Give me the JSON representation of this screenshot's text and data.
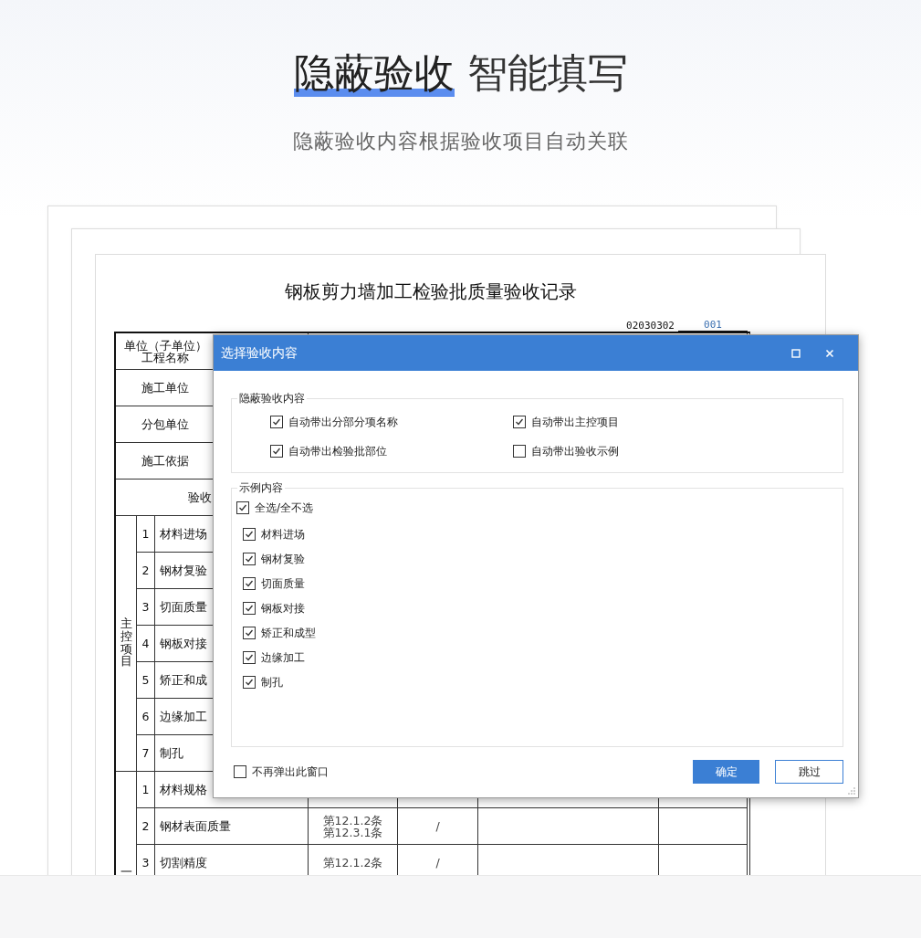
{
  "header": {
    "title_highlight": "隐蔽验收",
    "title_rest": "智能填写",
    "subtitle": "隐蔽验收内容根据验收项目自动关联"
  },
  "document": {
    "title": "钢板剪力墙加工检验批质量验收记录",
    "code": "02030302",
    "serial": "001",
    "info_rows": [
      {
        "lines": [
          "单位（子单位）",
          "工程名称"
        ]
      },
      {
        "lines": [
          "施工单位"
        ]
      },
      {
        "lines": [
          "分包单位"
        ]
      },
      {
        "lines": [
          "施工依据"
        ]
      }
    ],
    "section_label": "验收",
    "groups": [
      {
        "label": "主控项目",
        "rows": [
          {
            "no": "1",
            "name": "材料进场"
          },
          {
            "no": "2",
            "name": "钢材复验"
          },
          {
            "no": "3",
            "name": "切面质量"
          },
          {
            "no": "4",
            "name": "钢板对接"
          },
          {
            "no": "5",
            "name": "矫正和成"
          },
          {
            "no": "6",
            "name": "边缘加工"
          },
          {
            "no": "7",
            "name": "制孔"
          }
        ]
      },
      {
        "label": "一",
        "rows": [
          {
            "no": "1",
            "name": "材料规格"
          },
          {
            "no": "2",
            "name": "钢材表面质量",
            "clause": [
              "第12.1.2条",
              "第12.3.1条"
            ],
            "result": "/"
          },
          {
            "no": "3",
            "name": "切割精度",
            "clause": [
              "第12.1.2条"
            ],
            "result": "/"
          }
        ]
      }
    ]
  },
  "dialog": {
    "title": "选择验收内容",
    "hidden_group": {
      "title": "隐蔽验收内容",
      "options": [
        {
          "label": "自动带出分部分项名称",
          "checked": true
        },
        {
          "label": "自动带出主控项目",
          "checked": true
        },
        {
          "label": "自动带出检验批部位",
          "checked": true
        },
        {
          "label": "自动带出验收示例",
          "checked": false
        }
      ]
    },
    "example_group": {
      "title": "示例内容",
      "select_all": {
        "label": "全选/全不选",
        "checked": true
      },
      "items": [
        {
          "label": "材料进场",
          "checked": true
        },
        {
          "label": "钢材复验",
          "checked": true
        },
        {
          "label": "切面质量",
          "checked": true
        },
        {
          "label": "钢板对接",
          "checked": true
        },
        {
          "label": "矫正和成型",
          "checked": true
        },
        {
          "label": "边缘加工",
          "checked": true
        },
        {
          "label": "制孔",
          "checked": true
        }
      ]
    },
    "dont_show": {
      "label": "不再弹出此窗口",
      "checked": false
    },
    "buttons": [
      {
        "label": "确定",
        "kind": "primary"
      },
      {
        "label": "跳过",
        "kind": "secondary"
      }
    ]
  }
}
